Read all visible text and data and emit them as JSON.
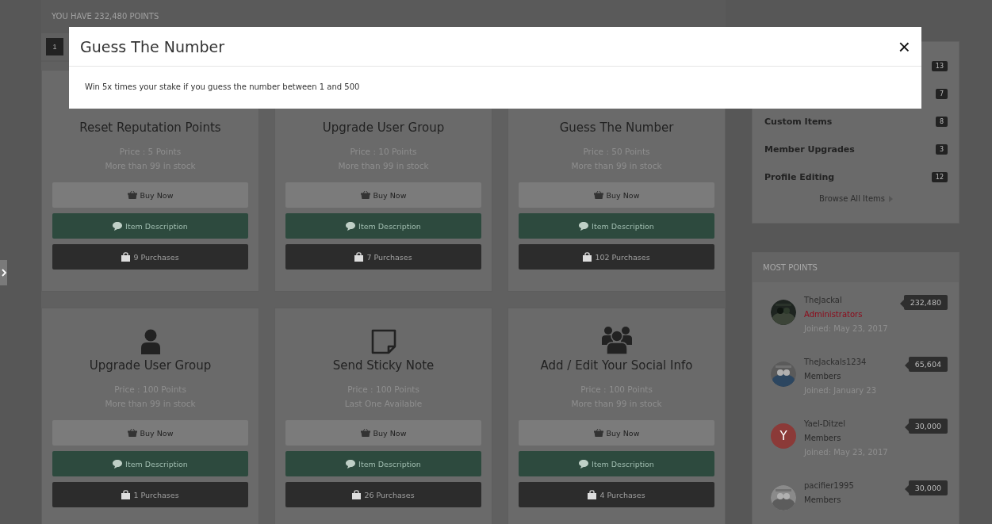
{
  "points_banner": "YOU HAVE 232,480 POINTS",
  "pagination": [
    {
      "label": "1",
      "selected": true
    }
  ],
  "items": [
    {
      "title": "Reset Reputation Points",
      "price": "Price : 5 Points",
      "stock": "More than 99 in stock",
      "buy": "Buy Now",
      "description": "Item Description",
      "purchases": "9 Purchases"
    },
    {
      "title": "Upgrade User Group",
      "price": "Price : 10 Points",
      "stock": "More than 99 in stock",
      "buy": "Buy Now",
      "description": "Item Description",
      "purchases": "7 Purchases"
    },
    {
      "title": "Guess The Number",
      "price": "Price : 50 Points",
      "stock": "More than 99 in stock",
      "buy": "Buy Now",
      "description": "Item Description",
      "purchases": "102 Purchases"
    },
    {
      "kind": "user",
      "title": "Upgrade User Group",
      "price": "Price : 100 Points",
      "stock": "More than 99 in stock",
      "buy": "Buy Now",
      "description": "Item Description",
      "purchases": "1 Purchases"
    },
    {
      "kind": "note",
      "title": "Send Sticky Note",
      "price": "Price : 100 Points",
      "stock": "Last One Available",
      "buy": "Buy Now",
      "description": "Item Description",
      "purchases": "26 Purchases"
    },
    {
      "kind": "users",
      "title": "Add / Edit Your Social Info",
      "price": "Price : 100 Points",
      "stock": "More than 99 in stock",
      "buy": "Buy Now",
      "description": "Item Description",
      "purchases": "4 Purchases"
    }
  ],
  "categories": {
    "items": [
      {
        "count": "13"
      },
      {
        "count": "7"
      },
      {
        "name": "Custom Items",
        "count": "8"
      },
      {
        "name": "Member Upgrades",
        "count": "3"
      },
      {
        "name": "Profile Editing",
        "count": "12"
      }
    ],
    "browse_link": "Browse All Items"
  },
  "most_points": {
    "title": "MOST POINTS",
    "members": [
      {
        "name": "TheJackal",
        "group": "Administrators",
        "color": "#8e0a1a",
        "joined": "Joined: May 23, 2017",
        "points": "232,480"
      },
      {
        "name": "TheJackals1234",
        "group": "Members",
        "color": "#2a2a2a",
        "joined": "Joined: January 23",
        "points": "65,604"
      },
      {
        "name": "Yael-Ditzel",
        "group": "Members",
        "color": "#2a2a2a",
        "joined": "Joined: May 23, 2017",
        "points": "30,000",
        "avatar": {
          "kind": "letter",
          "letter": "Y",
          "color": "#8b3a38"
        }
      },
      {
        "name": "pacifier1995",
        "group": "Members",
        "color": "#2a2a2a",
        "points": "30,000"
      }
    ]
  },
  "modal": {
    "title": "Guess The Number",
    "close": "×",
    "body": "Win 5x times your stake if you guess the number between 1 and 500"
  }
}
